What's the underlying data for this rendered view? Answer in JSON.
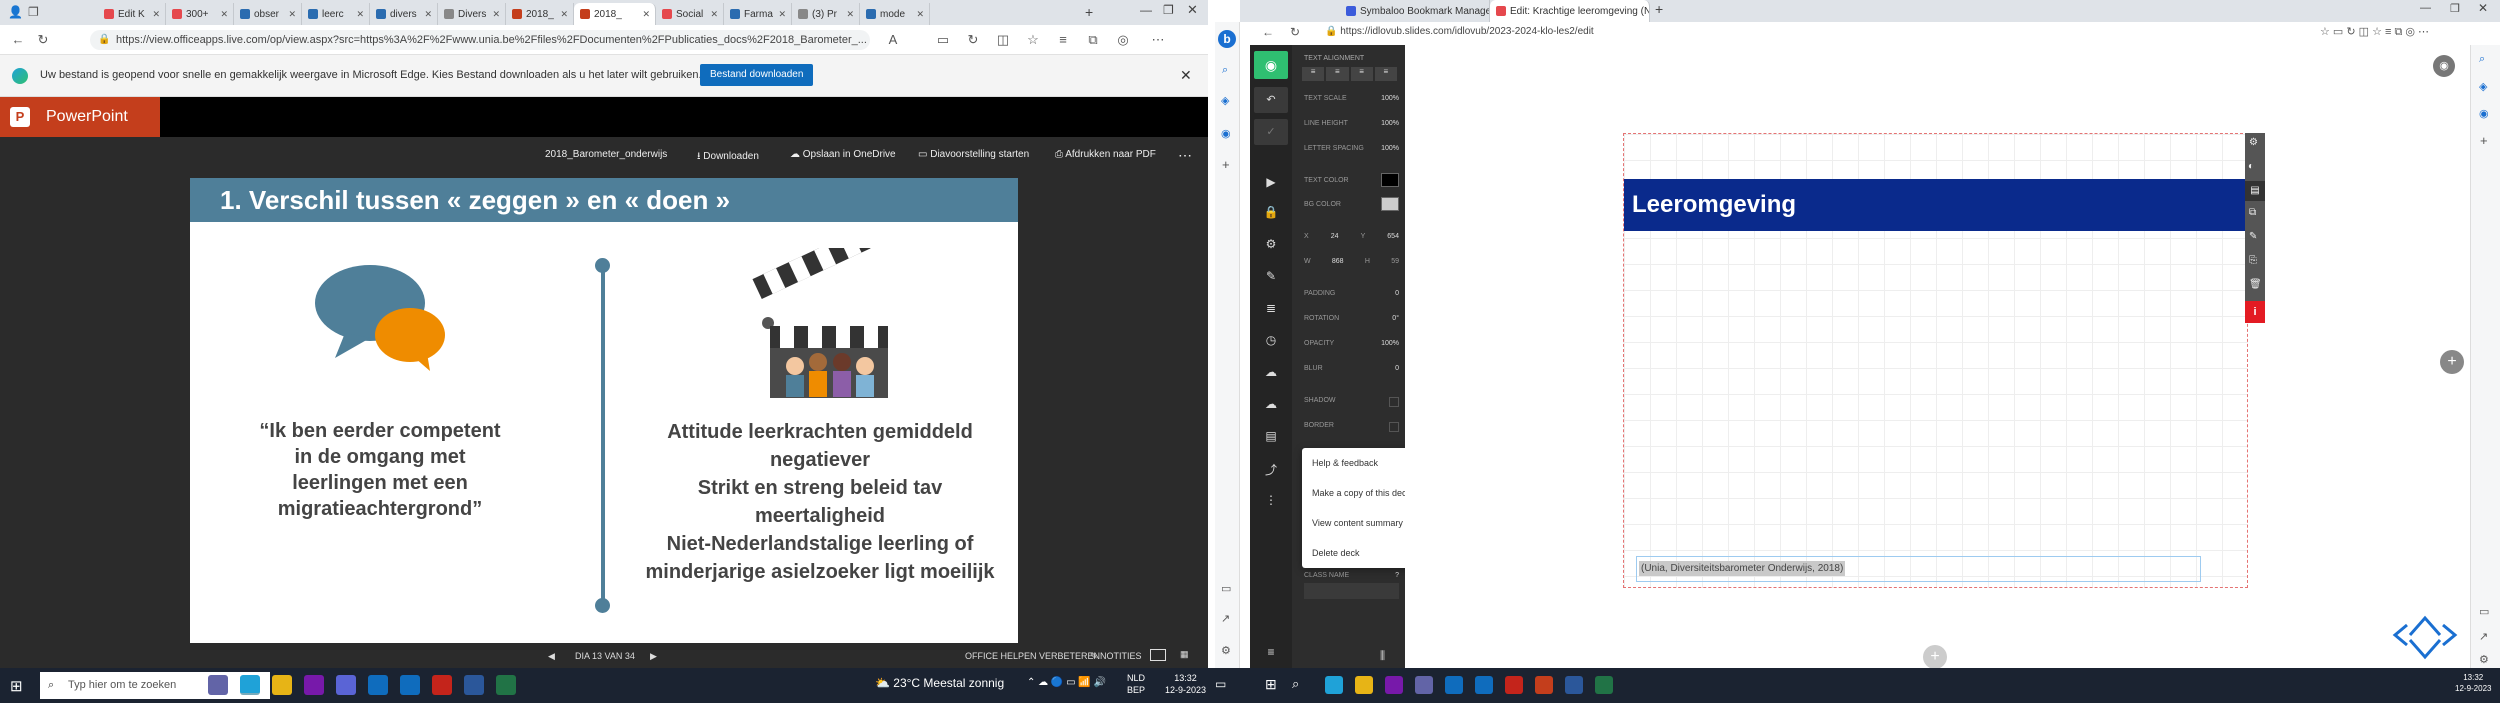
{
  "left_browser": {
    "tabs": [
      {
        "label": "Edit K",
        "color": "#e5484d"
      },
      {
        "label": "300+",
        "color": "#e5484d"
      },
      {
        "label": "obser",
        "color": "#2b6cb0"
      },
      {
        "label": "leerc",
        "color": "#2b6cb0"
      },
      {
        "label": "divers",
        "color": "#2b6cb0"
      },
      {
        "label": "Divers",
        "color": "#888888"
      },
      {
        "label": "2018_",
        "color": "#c43e1c"
      },
      {
        "label": "2018_",
        "color": "#c43e1c"
      },
      {
        "label": "Social",
        "color": "#e5484d"
      },
      {
        "label": "Farma",
        "color": "#2b6cb0"
      },
      {
        "label": "(3) Pr",
        "color": "#888888"
      },
      {
        "label": "mode",
        "color": "#2b6cb0"
      }
    ],
    "url": "https://view.officeapps.live.com/op/view.aspx?src=https%3A%2F%2Fwww.unia.be%2Ffiles%2FDocumenten%2FPublicaties_docs%2F2018_Barometer_...",
    "infobar": {
      "text": "Uw bestand is geopend voor snelle en gemakkelijk weergave in Microsoft Edge. Kies Bestand downloaden als u het later wilt gebruiken.",
      "button": "Bestand downloaden"
    }
  },
  "powerpoint": {
    "app_name": "PowerPoint",
    "file_name": "2018_Barometer_onderwijs",
    "toolbar": [
      "Downloaden",
      "Opslaan in OneDrive",
      "Diavoorstelling starten",
      "Afdrukken naar PDF"
    ],
    "slide": {
      "title": "1. Verschil tussen « zeggen » en « doen »",
      "left_text": "“Ik ben eerder competent in de omgang met leerlingen met een migratieachtergrond”",
      "right_text": "Attitude leerkrachten gemiddeld negatiever\nStrikt en streng beleid tav meertaligheid\nNiet-Nederlandstalige leerling of minderjarige asielzoeker ligt moeilijk"
    },
    "footer": {
      "page": "DIA 13 VAN 34",
      "help": "OFFICE HELPEN VERBETEREN",
      "notes": "NOTITIES"
    }
  },
  "right_browser": {
    "tabs": [
      {
        "label": "Symbaloo Bookmark Manager |",
        "color": "#3b5bdb"
      },
      {
        "label": "Edit: Krachtige leeromgeving (Nav",
        "color": "#e5484d"
      }
    ],
    "url": "https://idlovub.slides.com/idlovub/2023-2024-klo-les2/edit"
  },
  "slides_editor": {
    "panel": {
      "text_alignment": "TEXT ALIGNMENT",
      "text_scale": {
        "label": "TEXT SCALE",
        "value": "100%"
      },
      "line_height": {
        "label": "LINE HEIGHT",
        "value": "100%"
      },
      "letter_spacing": {
        "label": "LETTER SPACING",
        "value": "100%"
      },
      "text_color": "TEXT COLOR",
      "bg_color": "BG COLOR",
      "x": {
        "label": "X",
        "value": "24"
      },
      "y": {
        "label": "Y",
        "value": "654"
      },
      "w": {
        "label": "W",
        "value": "868"
      },
      "h": {
        "label": "H",
        "value": "59"
      },
      "padding": {
        "label": "PADDING",
        "value": "0"
      },
      "rotation": {
        "label": "ROTATION",
        "value": "0°"
      },
      "opacity": {
        "label": "OPACITY",
        "value": "100%"
      },
      "blur": {
        "label": "BLUR",
        "value": "0"
      },
      "shadow": "SHADOW",
      "border": "BORDER",
      "class_name": "CLASS NAME"
    },
    "menu": [
      {
        "label": "Help & feedback",
        "icon": "?"
      },
      {
        "label": "Make a copy of this deck",
        "icon": "copy"
      },
      {
        "label": "View content summary",
        "icon": "list"
      },
      {
        "label": "Delete deck",
        "icon": "trash"
      }
    ],
    "slide_title": "Leeromgeving",
    "citation": "(Unia, Diversiteitsbarometer Onderwijs, 2018)",
    "accent": "#0a2a8c"
  },
  "taskbar": {
    "search_placeholder": "Typ hier om te zoeken",
    "weather": "23°C  Meestal zonnig",
    "lang1": "NLD",
    "lang2": "BEP",
    "time": "13:32",
    "date": "12-9-2023",
    "time2": "13:32",
    "date2": "12-9-2023"
  }
}
